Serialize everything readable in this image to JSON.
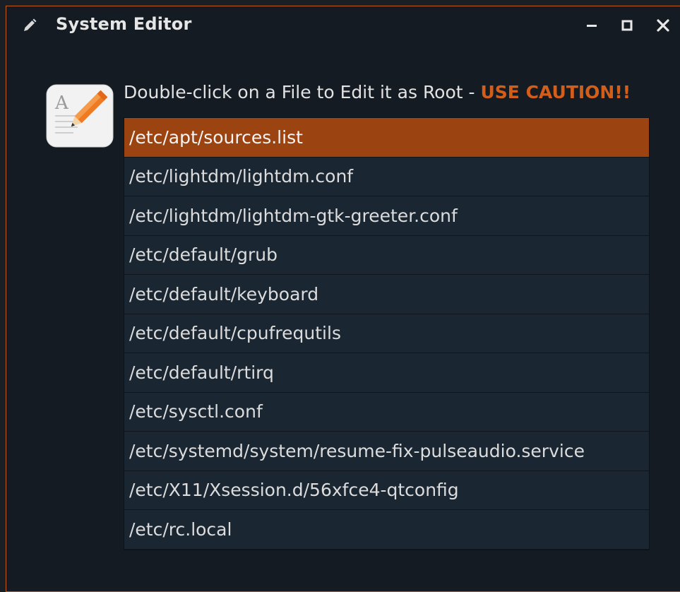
{
  "window": {
    "title": "System Editor",
    "title_icon": "pencil-icon",
    "controls": {
      "minimize_icon": "minimize-icon",
      "maximize_icon": "maximize-icon",
      "close_icon": "close-icon"
    }
  },
  "header": {
    "app_icon": "text-editor-icon",
    "instruction": "Double-click on a File to Edit it as Root - ",
    "caution": "USE CAUTION!!"
  },
  "files": [
    {
      "path": "/etc/apt/sources.list",
      "selected": true
    },
    {
      "path": "/etc/lightdm/lightdm.conf",
      "selected": false
    },
    {
      "path": "/etc/lightdm/lightdm-gtk-greeter.conf",
      "selected": false
    },
    {
      "path": "/etc/default/grub",
      "selected": false
    },
    {
      "path": "/etc/default/keyboard",
      "selected": false
    },
    {
      "path": "/etc/default/cpufrequtils",
      "selected": false
    },
    {
      "path": "/etc/default/rtirq",
      "selected": false
    },
    {
      "path": "/etc/sysctl.conf",
      "selected": false
    },
    {
      "path": "/etc/systemd/system/resume-fix-pulseaudio.service",
      "selected": false
    },
    {
      "path": "/etc/X11/Xsession.d/56xfce4-qtconfig",
      "selected": false
    },
    {
      "path": "/etc/rc.local",
      "selected": false
    }
  ],
  "colors": {
    "accent": "#d35e1a",
    "selection": "#9c4411",
    "window_border": "#c25a1c",
    "background": "#151b22",
    "list_background": "#1a2632"
  }
}
